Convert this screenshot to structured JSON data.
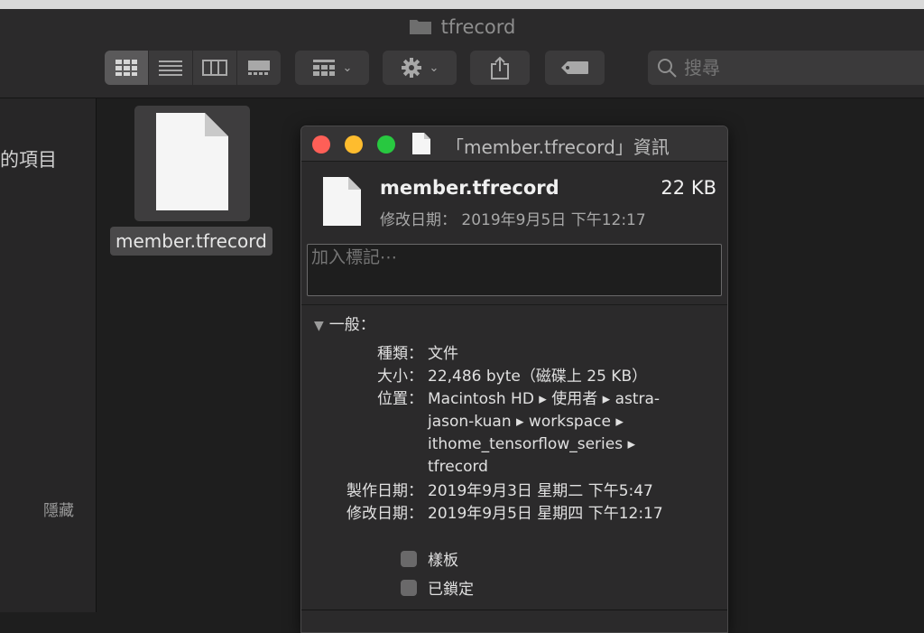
{
  "window": {
    "title": "tfrecord"
  },
  "toolbar": {
    "view_icons": [
      "icon-view-icon",
      "list-view-icon",
      "column-view-icon",
      "gallery-view-icon"
    ],
    "group_icon": "group-by-icon",
    "action_icon": "gear-icon",
    "share_icon": "share-icon",
    "tag_icon": "tag-icon"
  },
  "search": {
    "placeholder": "搜尋"
  },
  "sidebar": {
    "recent_label": "的項目",
    "hidden_label": "隱藏"
  },
  "finder_file": {
    "name": "member.tfrecord"
  },
  "info_panel": {
    "title": "「member.tfrecord」資訊",
    "file_name": "member.tfrecord",
    "file_size": "22 KB",
    "modified_line": "修改日期： 2019年9月5日 下午12:17",
    "tag_placeholder": "加入標記⋯",
    "general_label": "一般：",
    "rows": [
      {
        "key": "種類：",
        "value": "文件"
      },
      {
        "key": "大小：",
        "value": "22,486 byte（磁碟上 25 KB）"
      },
      {
        "key": "位置：",
        "value_lines": [
          "Macintosh HD ▸ 使用者 ▸ astra-",
          "jason-kuan ▸ workspace ▸",
          "ithome_tensorflow_series ▸",
          "tfrecord"
        ]
      },
      {
        "key": "製作日期：",
        "value": "2019年9月3日 星期二 下午5:47"
      },
      {
        "key": "修改日期：",
        "value": "2019年9月5日 星期四 下午12:17"
      }
    ],
    "checkboxes": [
      {
        "label": "樣板",
        "checked": false
      },
      {
        "label": "已鎖定",
        "checked": false
      }
    ]
  },
  "colors": {
    "close": "#fe5f57",
    "minimize": "#febc2e",
    "zoom": "#28c840"
  }
}
